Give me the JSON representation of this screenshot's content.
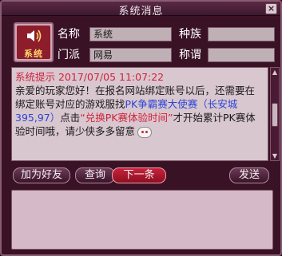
{
  "window": {
    "title": "系统消息",
    "close_label": "×"
  },
  "sender": {
    "avatar_label": "系统",
    "fields": [
      {
        "label": "名称",
        "value": "系统"
      },
      {
        "label": "种族",
        "value": ""
      },
      {
        "label": "门派",
        "value": "网易"
      },
      {
        "label": "称谓",
        "value": ""
      }
    ]
  },
  "message": {
    "head": "系统提示 2017/07/05 11:07:22",
    "p1": "亲爱的玩家您好！在报名网站绑定账号以后，还需要在绑定账号对应的游戏服找",
    "npc": "PK争霸赛大使赛（长安城 395,97）",
    "p2": "点击",
    "action": "“兑换PK赛体验时间”",
    "p3": "才开始累计PK赛体验时间哦，请少侠多多留意"
  },
  "buttons": {
    "add_friend": "加为好友",
    "query": "查询",
    "next": "下一条",
    "send": "发送"
  },
  "reply_input": {
    "value": ""
  }
}
